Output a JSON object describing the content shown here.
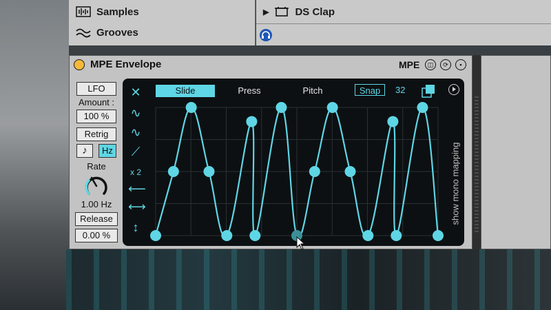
{
  "browser": {
    "items": [
      {
        "label": "Samples",
        "icon": "waveform-icon"
      },
      {
        "label": "Grooves",
        "icon": "tilde-icon"
      }
    ],
    "preview": {
      "label": "DS Clap",
      "icon": "drum-rack-icon"
    },
    "headphone_icon": "headphone-icon"
  },
  "device": {
    "title": "MPE Envelope",
    "mpe_label": "MPE",
    "power_color": "#f4b93a",
    "controls": {
      "mode": "LFO",
      "amount_label": "Amount :",
      "amount_value": "100 %",
      "retrig": "Retrig",
      "note_glyph": "♪",
      "hz": "Hz",
      "rate_label": "Rate",
      "rate_value": "1.00 Hz",
      "release_label": "Release",
      "release_value": "0.00 %"
    },
    "display": {
      "tabs": [
        "Slide",
        "Press",
        "Pitch"
      ],
      "active_tab": "Slide",
      "snap": "Snap",
      "grid": "32",
      "side_label": "show mono mapping",
      "tools": [
        "✕",
        "∿",
        "∿",
        "⟋",
        "x 2",
        "⟵",
        "⟷",
        "↕"
      ],
      "accent": "#5fd6e5"
    }
  },
  "envelope": {
    "y_range": [
      0,
      1
    ],
    "x_range": [
      0,
      1
    ],
    "points": [
      {
        "x": 0.0,
        "y": 0.0
      },
      {
        "x": 0.063,
        "y": 0.5
      },
      {
        "x": 0.126,
        "y": 1.0
      },
      {
        "x": 0.189,
        "y": 0.5
      },
      {
        "x": 0.252,
        "y": 0.0
      },
      {
        "x": 0.34,
        "y": 0.89
      },
      {
        "x": 0.352,
        "y": 0.0
      },
      {
        "x": 0.445,
        "y": 1.0
      },
      {
        "x": 0.5,
        "y": 0.0
      },
      {
        "x": 0.563,
        "y": 0.5
      },
      {
        "x": 0.626,
        "y": 1.0
      },
      {
        "x": 0.689,
        "y": 0.5
      },
      {
        "x": 0.752,
        "y": 0.0
      },
      {
        "x": 0.84,
        "y": 0.89
      },
      {
        "x": 0.852,
        "y": 0.0
      },
      {
        "x": 0.945,
        "y": 1.0
      },
      {
        "x": 1.0,
        "y": 0.0
      }
    ],
    "selected_index": 8
  }
}
